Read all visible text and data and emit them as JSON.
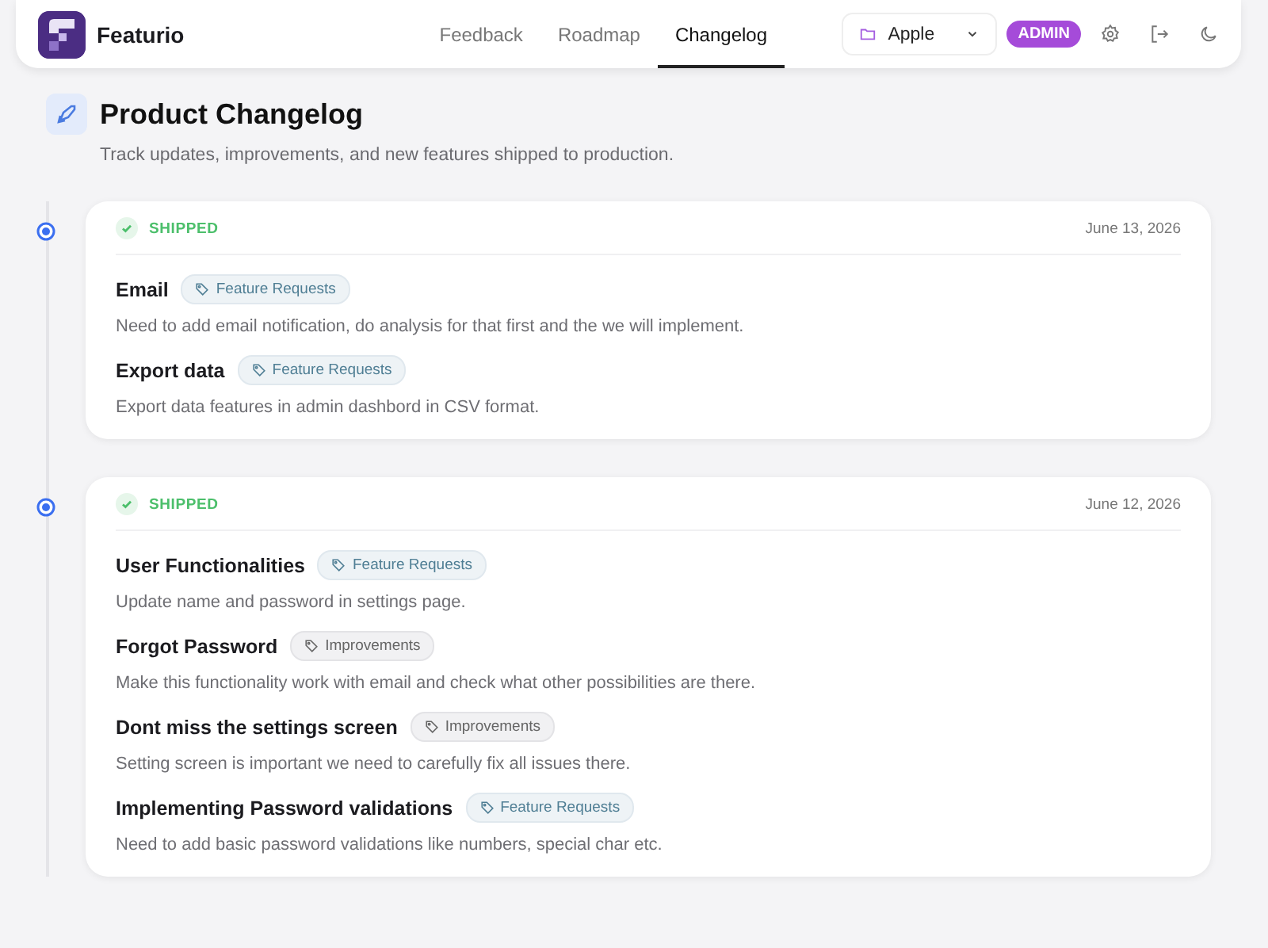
{
  "header": {
    "brand": "Featurio",
    "nav": [
      {
        "label": "Feedback",
        "selected": false
      },
      {
        "label": "Roadmap",
        "selected": false
      },
      {
        "label": "Changelog",
        "selected": true
      }
    ],
    "workspace": "Apple",
    "role_badge": "ADMIN"
  },
  "page": {
    "title": "Product Changelog",
    "subtitle": "Track updates, improvements, and new features shipped to production."
  },
  "releases": [
    {
      "status": "SHIPPED",
      "date": "June 13, 2026",
      "items": [
        {
          "title": "Email",
          "tag": {
            "label": "Feature Requests",
            "kind": "feature"
          },
          "description": "Need to add email notification, do analysis for that first and the we will implement."
        },
        {
          "title": "Export data",
          "tag": {
            "label": "Feature Requests",
            "kind": "feature"
          },
          "description": "Export data features in admin dashbord in CSV format."
        }
      ]
    },
    {
      "status": "SHIPPED",
      "date": "June 12, 2026",
      "items": [
        {
          "title": "User Functionalities",
          "tag": {
            "label": "Feature Requests",
            "kind": "feature"
          },
          "description": "Update name and password in settings page."
        },
        {
          "title": "Forgot Password",
          "tag": {
            "label": "Improvements",
            "kind": "improvement"
          },
          "description": "Make this functionality work with email and check what other possibilities are there."
        },
        {
          "title": "Dont miss the settings screen",
          "tag": {
            "label": "Improvements",
            "kind": "improvement"
          },
          "description": "Setting screen is important we need to carefully fix all issues there."
        },
        {
          "title": "Implementing Password validations",
          "tag": {
            "label": "Feature Requests",
            "kind": "feature"
          },
          "description": "Need to add basic password validations like numbers, special char etc."
        }
      ]
    }
  ]
}
